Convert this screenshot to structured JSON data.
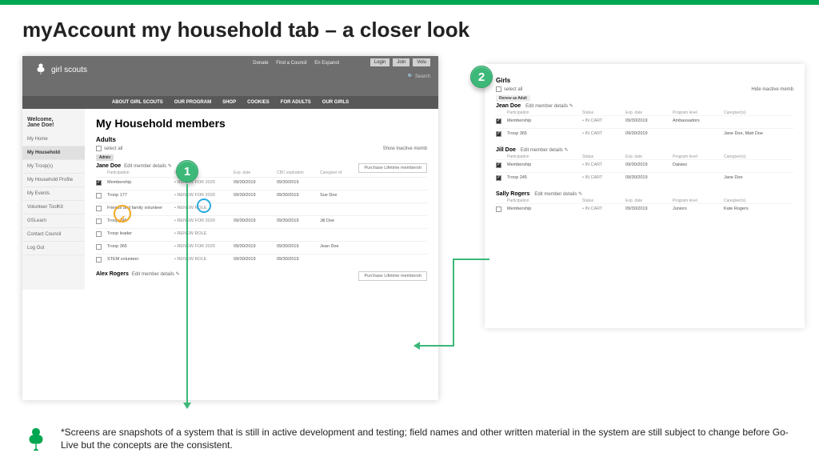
{
  "slide": {
    "title": "myAccount my household tab – a closer look",
    "footnote": "*Screens are snapshots of a system that is still in active development and testing; field names and other written material in the system are still subject to change before Go-Live but the concepts are the consistent."
  },
  "badges": {
    "one": "1",
    "two": "2"
  },
  "gs": {
    "brand": "girl scouts",
    "topnav": {
      "donate": "Donate",
      "find": "Find a Council",
      "espanol": "En Espanol"
    },
    "buttons": {
      "login": "Login",
      "join": "Join",
      "volu": "Volu"
    },
    "search": "Search",
    "mainnav": [
      "ABOUT GIRL SCOUTS",
      "OUR PROGRAM",
      "SHOP",
      "COOKIES",
      "FOR ADULTS",
      "OUR GIRLS"
    ],
    "welcome": "Welcome,\nJane Doe!",
    "sidebar": [
      "My Home",
      "My Household",
      "My Troop(s)",
      "My Household Profile",
      "My Events",
      "Volunteer ToolKit",
      "GSLearn",
      "Contact Council",
      "Log Out"
    ],
    "page_title": "My Household members"
  },
  "adults": {
    "heading": "Adults",
    "select_all": "select all",
    "show_inactive": "Show inactive memb",
    "admin_tag": "Admin",
    "edit": "Edit member details",
    "purchase": "Purchase Lifetime membersh",
    "col": {
      "part": "Participation",
      "status": "Status",
      "exp": "Exp. date",
      "cbc": "CBC expiration",
      "care": "Caregiver of"
    },
    "members": [
      {
        "name": "Jane Doe",
        "rows": [
          {
            "cb": true,
            "name": "Membership",
            "status": "• RENEW FOR 2020",
            "d1": "09/30/2019",
            "d2": "09/30/2019",
            "care": ""
          },
          {
            "cb": false,
            "name": "Troop 177",
            "status": "• RENEW FOR 2020",
            "d1": "09/30/2019",
            "d2": "09/30/2019",
            "care": "Sue Doe"
          },
          {
            "cb": false,
            "name": "Friends and family volunteer",
            "status": "• RENEW ROLE",
            "d1": "",
            "d2": "",
            "care": ""
          },
          {
            "cb": false,
            "name": "Troop 245",
            "status": "• RENEW FOR 2020",
            "d1": "09/30/2019",
            "d2": "09/30/2019",
            "care": "Jill Doe"
          },
          {
            "cb": false,
            "name": "Troop leader",
            "status": "• RENEW ROLE",
            "d1": "",
            "d2": "",
            "care": ""
          },
          {
            "cb": false,
            "name": "Troop 365",
            "status": "• RENEW FOR 2020",
            "d1": "09/30/2019",
            "d2": "09/30/2019",
            "care": "Jean Doe"
          },
          {
            "cb": false,
            "name": "STEM volunteer",
            "status": "• RENEW ROLE",
            "d1": "09/30/2019",
            "d2": "09/30/2019",
            "care": ""
          }
        ]
      },
      {
        "name": "Alex Rogers",
        "rows": []
      }
    ]
  },
  "girls": {
    "heading": "Girls",
    "select_all": "select all",
    "hide_inactive": "Hide inactive memb",
    "renew_tag": "Renew as Adult",
    "edit": "Edit member details",
    "col": {
      "part": "Participation",
      "status": "Status",
      "exp": "Exp. date",
      "prog": "Program level",
      "care": "Caregiver(s)"
    },
    "members": [
      {
        "name": "Jean Doe",
        "rows": [
          {
            "cb": true,
            "name": "Membership",
            "status": "• IN CART",
            "d1": "09/30/2019",
            "prog": "Ambassadors",
            "care": ""
          },
          {
            "cb": true,
            "name": "Troop 365",
            "status": "• IN CART",
            "d1": "09/30/2019",
            "prog": "",
            "care": "Jane Doe, Matt Doe"
          }
        ]
      },
      {
        "name": "Jill Doe",
        "rows": [
          {
            "cb": true,
            "name": "Membership",
            "status": "• IN CART",
            "d1": "09/30/2019",
            "prog": "Daisies",
            "care": ""
          },
          {
            "cb": true,
            "name": "Troop 245",
            "status": "• IN CART",
            "d1": "09/30/2019",
            "prog": "",
            "care": "Jane Doe"
          }
        ]
      },
      {
        "name": "Sally Rogers",
        "rows": [
          {
            "cb": false,
            "name": "Membership",
            "status": "• IN CART",
            "d1": "09/30/2019",
            "prog": "Juniors",
            "care": "Kate Rogers"
          }
        ]
      }
    ]
  }
}
